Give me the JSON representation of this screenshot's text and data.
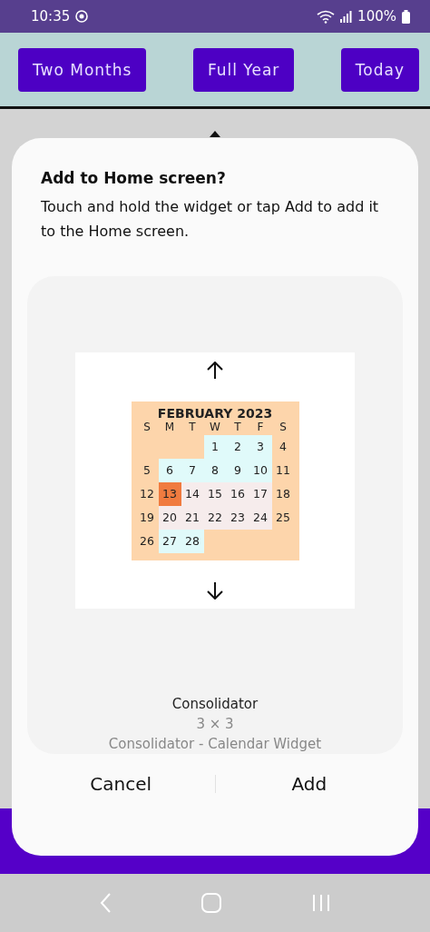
{
  "status_bar": {
    "time": "10:35",
    "battery": "100%"
  },
  "toolbar": {
    "buttons": [
      "Two Months",
      "Full Year",
      "Today"
    ]
  },
  "dialog": {
    "title": "Add to Home screen?",
    "message": "Touch and hold the widget or tap Add to add it to the Home screen.",
    "widget_preview": {
      "month_title": "FEBRUARY 2023",
      "weekdays": [
        "S",
        "M",
        "T",
        "W",
        "T",
        "F",
        "S"
      ],
      "weeks": [
        [
          {
            "kind": "blank"
          },
          {
            "kind": "blank"
          },
          {
            "kind": "blank"
          },
          {
            "kind": "day",
            "day": "1",
            "color": "#e0fafa"
          },
          {
            "kind": "day",
            "day": "2",
            "color": "#e0fafa"
          },
          {
            "kind": "day",
            "day": "3",
            "color": "#e0fafa"
          },
          {
            "kind": "day",
            "day": "4",
            "color": "#fdd5ab"
          }
        ],
        [
          {
            "kind": "day",
            "day": "5",
            "color": "#fdd5ab"
          },
          {
            "kind": "day",
            "day": "6",
            "color": "#e0fafa"
          },
          {
            "kind": "day",
            "day": "7",
            "color": "#e0fafa"
          },
          {
            "kind": "day",
            "day": "8",
            "color": "#e0fafa"
          },
          {
            "kind": "day",
            "day": "9",
            "color": "#e0fafa"
          },
          {
            "kind": "day",
            "day": "10",
            "color": "#e0fafa"
          },
          {
            "kind": "day",
            "day": "11",
            "color": "#fdd5ab"
          }
        ],
        [
          {
            "kind": "day",
            "day": "12",
            "color": "#fdd5ab"
          },
          {
            "kind": "day",
            "day": "13",
            "color": "#f07b3f"
          },
          {
            "kind": "day",
            "day": "14",
            "color": "#f6ecec"
          },
          {
            "kind": "day",
            "day": "15",
            "color": "#f6ecec"
          },
          {
            "kind": "day",
            "day": "16",
            "color": "#f6ecec"
          },
          {
            "kind": "day",
            "day": "17",
            "color": "#f6ecec"
          },
          {
            "kind": "day",
            "day": "18",
            "color": "#fdd5ab"
          }
        ],
        [
          {
            "kind": "day",
            "day": "19",
            "color": "#fdd5ab"
          },
          {
            "kind": "day",
            "day": "20",
            "color": "#f6ecec"
          },
          {
            "kind": "day",
            "day": "21",
            "color": "#f6ecec"
          },
          {
            "kind": "day",
            "day": "22",
            "color": "#f6ecec"
          },
          {
            "kind": "day",
            "day": "23",
            "color": "#f6ecec"
          },
          {
            "kind": "day",
            "day": "24",
            "color": "#f6ecec"
          },
          {
            "kind": "day",
            "day": "25",
            "color": "#fdd5ab"
          }
        ],
        [
          {
            "kind": "day",
            "day": "26",
            "color": "#fdd5ab"
          },
          {
            "kind": "day",
            "day": "27",
            "color": "#e0fafa"
          },
          {
            "kind": "day",
            "day": "28",
            "color": "#e0fafa"
          },
          {
            "kind": "blank"
          },
          {
            "kind": "blank"
          },
          {
            "kind": "blank"
          },
          {
            "kind": "blank"
          }
        ]
      ]
    },
    "app_name": "Consolidator",
    "size": "3 × 3",
    "widget_name": "Consolidator - Calendar Widget",
    "buttons": [
      "Cancel",
      "Add"
    ]
  }
}
